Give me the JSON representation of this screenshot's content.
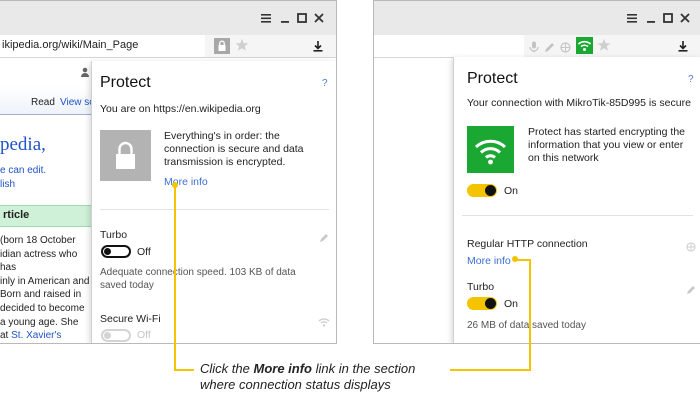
{
  "left": {
    "address": "ikipedia.org/wiki/Main_Page",
    "wiki": {
      "tab_read": "Read",
      "tab_view": "View so",
      "heading_fragment": "pedia,",
      "line_can_edit": "e can edit.",
      "line_lish": "lish",
      "article_box": "rticle",
      "body_lines": [
        "(born 18 October",
        "idian actress who has",
        "inly in American and",
        "Born and raised in",
        "decided to become",
        "a young age. She"
      ],
      "last_line_prefix": "at",
      "last_line_link": "St. Xavier's"
    },
    "popup": {
      "title": "Protect",
      "help": "?",
      "site_line": "You are on https://en.wikipedia.org",
      "status_text": "Everything's in order: the connection is secure and data transmission is encrypted.",
      "more_info": "More info",
      "turbo_label": "Turbo",
      "turbo_state": "Off",
      "turbo_desc": "Adequate connection speed. 103 KB of data saved today",
      "wifi_label": "Secure Wi-Fi",
      "wifi_state": "Off"
    }
  },
  "right": {
    "popup": {
      "title": "Protect",
      "help": "?",
      "conn_line": "Your connection with MikroTik-85D995 is secure",
      "status_text": "Protect has started encrypting the information that you view or enter on this network",
      "encrypt_state": "On",
      "http_label": "Regular HTTP connection",
      "more_info": "More info",
      "turbo_label": "Turbo",
      "turbo_state": "On",
      "turbo_desc": "26 MB of data saved today"
    }
  },
  "callout": {
    "line1_pre": "Click the",
    "line1_bold": "More info",
    "line1_post": "link in the section",
    "line2": "where connection status displays"
  },
  "colors": {
    "accent_yellow": "#f4c400",
    "wifi_green": "#1aa832",
    "link_blue": "#3c6fcf"
  },
  "icons": [
    "menu-icon",
    "maximize-icon",
    "close-icon",
    "lock-icon",
    "star-icon",
    "download-icon",
    "user-icon",
    "wifi-icon",
    "pencil-icon",
    "microphone-icon",
    "globe-icon"
  ]
}
